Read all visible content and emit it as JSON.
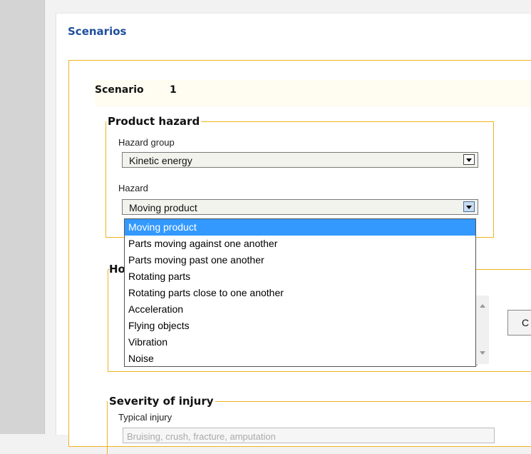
{
  "page": {
    "title": "Scenarios"
  },
  "scenario": {
    "label": "Scenario",
    "number": "1"
  },
  "product_hazard": {
    "legend": "Product hazard",
    "hazard_group": {
      "label": "Hazard group",
      "value": "Kinetic energy"
    },
    "hazard": {
      "label": "Hazard",
      "value": "Moving product"
    }
  },
  "dropdown": {
    "options": [
      "Moving product",
      "Parts moving against one another",
      "Parts moving past one another",
      "Rotating parts",
      "Rotating parts close to one another",
      "Acceleration",
      "Flying objects",
      "Vibration",
      "Noise"
    ],
    "selected_index": 0
  },
  "hidden_section": {
    "legend_visible": "Ho",
    "button_label": "C"
  },
  "severity": {
    "legend": "Severity of injury",
    "typical_injury": {
      "label": "Typical injury",
      "value": "Bruising, crush, fracture, amputation"
    }
  },
  "colors": {
    "title_blue": "#1f4e9b",
    "border_orange": "#f0b323",
    "selection_blue": "#3399ff"
  }
}
